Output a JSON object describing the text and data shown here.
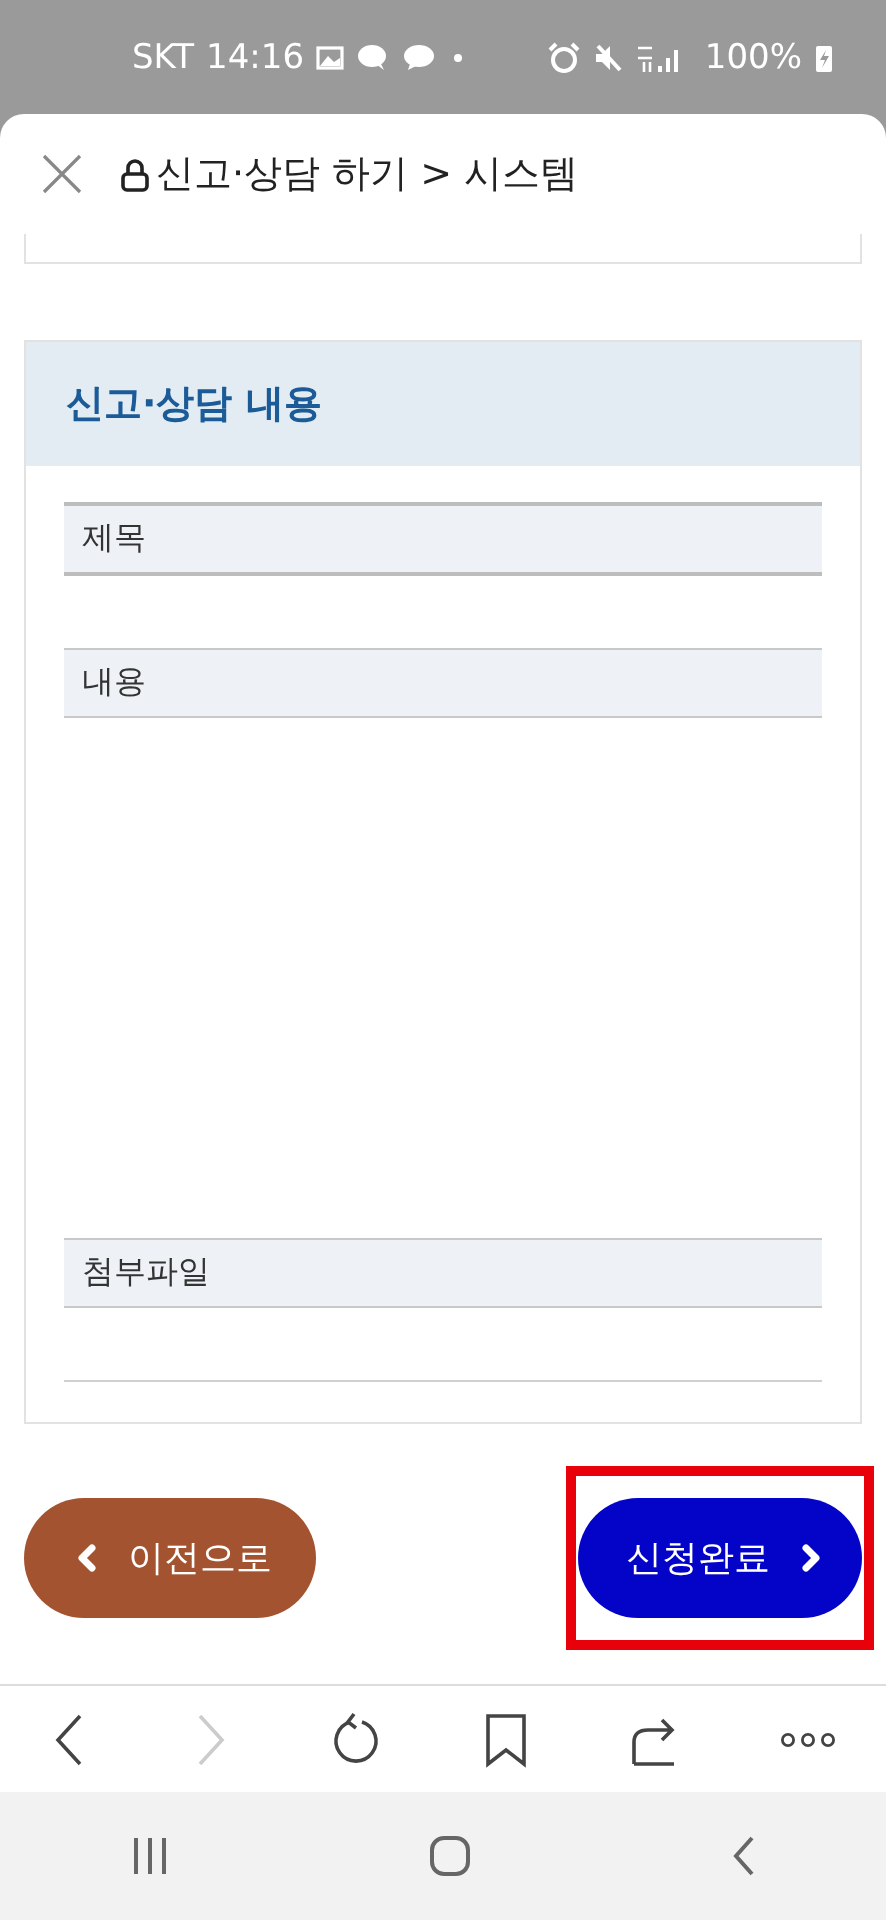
{
  "status_bar": {
    "carrier": "SKT",
    "time": "14:16",
    "battery": "100%"
  },
  "header": {
    "title": "신고·상담 하기 > 시스템"
  },
  "section": {
    "title": "신고·상담 내용",
    "fields": [
      {
        "label": "제목",
        "kind": "line"
      },
      {
        "label": "내용",
        "kind": "area"
      },
      {
        "label": "첨부파일",
        "kind": "line"
      }
    ]
  },
  "buttons": [
    {
      "label": "이전으로",
      "kind": "back",
      "highlighted": false
    },
    {
      "label": "신청완료",
      "kind": "next",
      "highlighted": true
    }
  ]
}
